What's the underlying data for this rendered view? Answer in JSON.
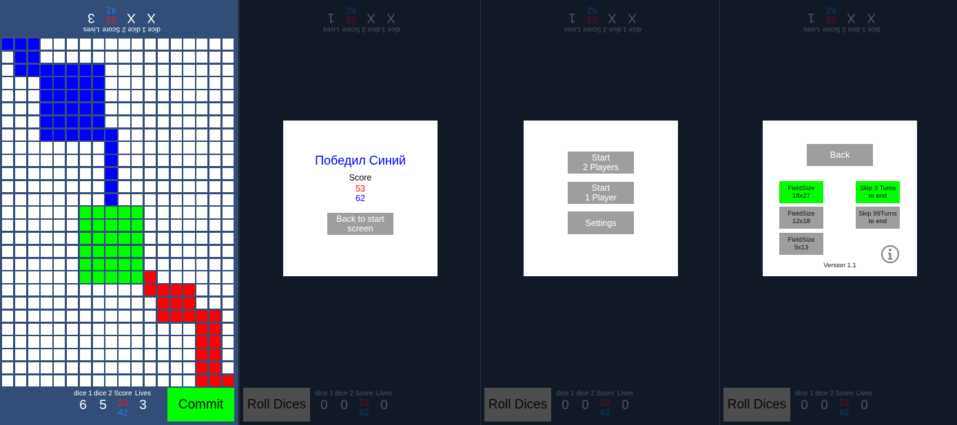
{
  "colors": {
    "blue_player": "#0000ff",
    "green_player": "#00ff00",
    "red_player": "#ff0000",
    "board_bg": "#324e78",
    "overlay_bg": "#111927",
    "button_gray": "#9e9e9e"
  },
  "hud_labels": {
    "dice1": "dice 1",
    "dice2": "dice 2",
    "score": "Score",
    "lives": "Lives"
  },
  "game": {
    "top_player": {
      "dice1": "X",
      "dice2": "X",
      "score_red": "23",
      "score_blue": "42",
      "lives": "3"
    },
    "bottom_player": {
      "dice1": "6",
      "dice2": "5",
      "score_red": "23",
      "score_blue": "42",
      "lives": "3"
    },
    "commit_label": "Commit",
    "grid": [
      "BBB...............",
      ".BB...............",
      ".BBBBBBB..........",
      "...BBBBB..........",
      "...BBBBB..........",
      "...BBBBB..........",
      "...BBBBB..........",
      "...BBBBBB.........",
      "........B.........",
      "........B.........",
      "........B.........",
      "........B.........",
      "........B.........",
      "......GGGGG.......",
      "......GGGGG.......",
      "......GGGGG.......",
      "......GGGGG.......",
      "......GGGGG.......",
      "......GGGGGR......",
      "...........RRRR...",
      "............RRR...",
      "............RRRRR.",
      "...............RR.",
      "...............RR.",
      "...............RR.",
      "...............RR.",
      "...............RRR"
    ]
  },
  "overlay_hud": {
    "top": {
      "dice1": "X",
      "dice2": "X",
      "score_red": "53",
      "score_blue": "62",
      "lives": "1"
    },
    "bottom": {
      "dice1": "0",
      "dice2": "0",
      "score_red": "53",
      "score_blue": "62",
      "lives": "0"
    },
    "roll_label": "Roll Dices"
  },
  "game_over": {
    "title": "Победил Синий",
    "score_label": "Score",
    "score_red": "53",
    "score_blue": "62",
    "back_label": "Back to start\nscreen"
  },
  "main_menu": {
    "start2": "Start\n2 Players",
    "start1": "Start\n1 Player",
    "settings": "Settings"
  },
  "settings": {
    "back": "Back",
    "field_sizes": [
      {
        "label": "FieldSize\n18x27",
        "selected": true
      },
      {
        "label": "FieldSize\n12x18",
        "selected": false
      },
      {
        "label": "FieldSize\n9x13",
        "selected": false
      }
    ],
    "skip_options": [
      {
        "label": "Skip 3 Turns\nto end",
        "selected": true
      },
      {
        "label": "Skip 99Turns\nto end",
        "selected": false
      }
    ],
    "info_icon": "info-icon",
    "version": "Version 1.1"
  }
}
